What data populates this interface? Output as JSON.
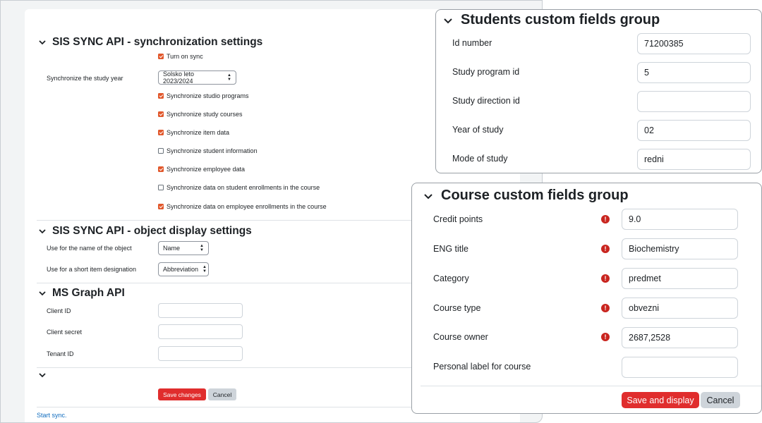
{
  "sync_settings": {
    "title": "SIS SYNC API - synchronization settings",
    "turn_on_sync": {
      "label": "Turn on sync",
      "checked": true
    },
    "study_year_label": "Synchronize the study year",
    "study_year_value": "Solsko leto 2023/2024",
    "checkboxes": [
      {
        "label": "Synchronize studio programs",
        "checked": true
      },
      {
        "label": "Synchronize study courses",
        "checked": true
      },
      {
        "label": "Synchronize item data",
        "checked": true
      },
      {
        "label": "Synchronize student information",
        "checked": false
      },
      {
        "label": "Synchronize employee data",
        "checked": true
      },
      {
        "label": "Synchronize data on student enrollments in the course",
        "checked": false
      },
      {
        "label": "Synchronize data on employee enrollments in the course",
        "checked": true
      }
    ]
  },
  "display_settings": {
    "title": "SIS SYNC API - object display settings",
    "name_label": "Use for the name of the object",
    "name_value": "Name",
    "short_label": "Use for a short item designation",
    "short_value": "Abbreviation"
  },
  "ms_graph": {
    "title": "MS Graph API",
    "client_id_label": "Client ID",
    "client_secret_label": "Client secret",
    "tenant_id_label": "Tenant ID"
  },
  "actions": {
    "save_label": "Save changes",
    "cancel_label": "Cancel",
    "start_sync_label": "Start sync."
  },
  "students_group": {
    "title": "Students custom fields group",
    "fields": [
      {
        "label": "Id number",
        "value": "71200385"
      },
      {
        "label": "Study program id",
        "value": "5"
      },
      {
        "label": "Study direction id",
        "value": ""
      },
      {
        "label": "Year of study",
        "value": "02"
      },
      {
        "label": "Mode of study",
        "value": "redni"
      }
    ]
  },
  "course_group": {
    "title": "Course custom fields group",
    "fields": [
      {
        "label": "Credit points",
        "value": "9.0",
        "required": true
      },
      {
        "label": "ENG title",
        "value": "Biochemistry",
        "required": true
      },
      {
        "label": "Category",
        "value": "predmet",
        "required": true
      },
      {
        "label": "Course type",
        "value": "obvezni",
        "required": true
      },
      {
        "label": "Course owner",
        "value": "2687,2528",
        "required": true
      },
      {
        "label": "Personal label for course",
        "value": "",
        "required": false
      }
    ],
    "save_label": "Save and display",
    "cancel_label": "Cancel",
    "required_mark": "!"
  },
  "colors": {
    "accent_red": "#e02d2d",
    "checkbox_orange": "#e1582c",
    "link_blue": "#0f6cbf"
  }
}
